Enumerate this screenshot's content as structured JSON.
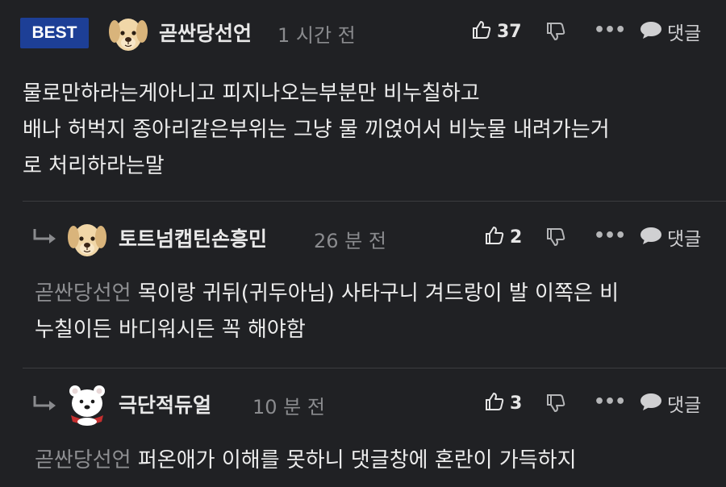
{
  "comments": [
    {
      "badge": "BEST",
      "nickname": "곧싼당선언",
      "time": "1 시간 전",
      "likes": "37",
      "more": "•••",
      "reply_label": "댓글",
      "lines": [
        "물로만하라는게아니고 피지나오는부분만 비누칠하고",
        "배나 허벅지 종아리같은부위는 그냥 물 끼얹어서 비눗물 내려가는거",
        "로 처리하라는말"
      ]
    },
    {
      "nickname": "토트넘캡틴손흥민",
      "time": "26 분 전",
      "likes": "2",
      "more": "•••",
      "reply_label": "댓글",
      "mention": "곧싼당선언",
      "lines": [
        "목이랑 귀뒤(귀두아님) 사타구니 겨드랑이 발 이쪽은 비",
        "누칠이든 바디워시든 꼭 해야함"
      ]
    },
    {
      "nickname": "극단적듀얼",
      "time": "10 분 전",
      "likes": "3",
      "more": "•••",
      "reply_label": "댓글",
      "mention": "곧싼당선언",
      "lines": [
        "퍼온애가 이해를 못하니 댓글창에 혼란이 가득하지"
      ]
    }
  ],
  "colors": {
    "background": "#202124",
    "badge": "#1d3f96",
    "muted": "#8a8b8e",
    "text": "#ededed"
  },
  "icons": [
    "puppy-avatar",
    "polar-bear-avatar",
    "reply-arrow-icon",
    "thumbs-up-icon",
    "thumbs-down-icon",
    "more-icon",
    "speech-bubble-icon"
  ]
}
